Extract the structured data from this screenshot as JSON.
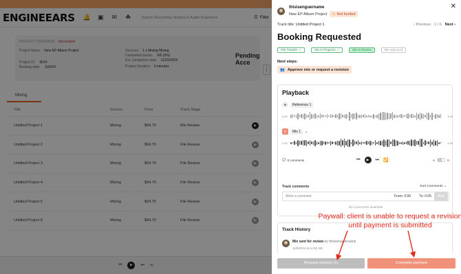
{
  "background": {
    "promo_text": "",
    "logo": "ENGINEEARS",
    "search_placeholder": "Search Recording Studios & Audio Engineers",
    "filter_label": "Filter",
    "project": {
      "tag": "PROJECT OVERVIEW",
      "funding": "Not funded",
      "name_label": "Project Name",
      "name_value": "New EP Album Project",
      "id_label": "Project ID:",
      "id_value": "9014",
      "booking_label": "Booking date:",
      "booking_value": "11/8/24",
      "services_label": "Services",
      "services_value": "1 x Mixing Mixing",
      "completed_label": "Completed tracks:",
      "completed_value": "0/6 (0%)",
      "est_label": "Est. completion date",
      "est_value": "11/23/2024",
      "duration_label": "Project Duration",
      "duration_value": "0 minutes",
      "pending_text": "Pending Acce"
    },
    "tab_label": "Mixing",
    "table": {
      "headers": [
        "Title",
        "Service",
        "Price",
        "Track Stage"
      ],
      "rows": [
        {
          "title": "Untitled Project 1",
          "service": "Mixing",
          "price": "$94.70",
          "stage": "Mix Review"
        },
        {
          "title": "Untitled Project 2",
          "service": "Mixing",
          "price": "$94.70",
          "stage": "File Review"
        },
        {
          "title": "Untitled Project 3",
          "service": "Mixing",
          "price": "$94.70",
          "stage": "File Review"
        },
        {
          "title": "Untitled Project 4",
          "service": "Mixing",
          "price": "$94.70",
          "stage": "File Review"
        },
        {
          "title": "Untitled Project 5",
          "service": "Mixing",
          "price": "$94.70",
          "stage": "File Review"
        },
        {
          "title": "Untitled Project 6",
          "service": "Mixing",
          "price": "$94.70",
          "stage": "File Review"
        }
      ]
    }
  },
  "drawer": {
    "username": "thisisenguername",
    "project_name": "New EP Album Project",
    "funding_badge": "Not funded",
    "track_title_label": "Track title:",
    "track_title_value": "Untitled Project 1",
    "pager_prev": "Previous",
    "pager_count": "1 / 6",
    "pager_next": "Next",
    "heading": "Booking Requested",
    "stages": [
      {
        "label": "File Transfer",
        "state": "done"
      },
      {
        "label": "Mix In Progress",
        "state": "done"
      },
      {
        "label": "Mix In Review",
        "state": "active"
      },
      {
        "label": "Mix Approved",
        "state": "pending"
      }
    ],
    "next_steps_label": "Next steps:",
    "next_step_action": "Approve mix or request a revision",
    "playback": {
      "title": "Playback",
      "track_a_letter": "A",
      "track_a_label": "Reference 1",
      "track_a_start": "0:00",
      "track_a_end": "3:36",
      "track_b_letter": "V",
      "track_b_label": "Mix 1",
      "track_b_start": "0:00",
      "track_b_end": "3:36",
      "comments_count": "0 comments",
      "ab_a": "A",
      "ab_b": "B"
    },
    "comments": {
      "label": "Track comments",
      "sort": "Sort Comments",
      "placeholder": "Write a comment",
      "from_label": "From:",
      "from_value": "0:00",
      "to_label": "To:",
      "to_value": "0:05",
      "add": "Add",
      "empty": "No comments available"
    },
    "history": {
      "title": "Track History",
      "event": "Mix sent for review",
      "by": "by thisisenguername",
      "date": "11/8/2024 at 11:50 AM"
    },
    "footer": {
      "request_revision": "Request revision (1)",
      "complete_payment": "Complete payment"
    }
  },
  "annotation": {
    "text": "Paywall: client is unable to request a revision until payment is submitted",
    "color": "#e0281b"
  },
  "colors": {
    "accent": "#f05a28",
    "stage_green": "#5cbb7a",
    "pay_button": "#f0917a",
    "disabled_button": "#bdbdbd"
  }
}
